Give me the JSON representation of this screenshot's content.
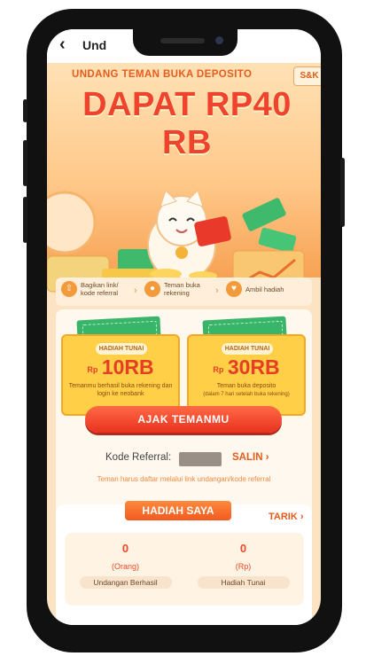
{
  "appbar": {
    "title": "Und",
    "back_icon": "chevron-left-icon"
  },
  "hero": {
    "subtitle": "UNDANG TEMAN BUKA DEPOSITO",
    "title": "DAPAT RP40 RB",
    "badge": "S&K"
  },
  "steps": [
    {
      "label": "Bagikan link/ kode referral",
      "icon": "share-icon"
    },
    {
      "label": "Teman buka rekening",
      "icon": "user-icon"
    },
    {
      "label": "Ambil hadiah",
      "icon": "gift-icon"
    }
  ],
  "coupons": [
    {
      "ribbon": "HADIAH TUNAI",
      "currency": "Rp",
      "amount": "10RB",
      "desc": "Temanmu berhasil buka rekening dan login ke neobank",
      "desc_note": ""
    },
    {
      "ribbon": "HADIAH TUNAI",
      "currency": "Rp",
      "amount": "30RB",
      "desc": "Teman buka deposito",
      "desc_note": "(dalam 7 hari setelah buka rekening)"
    }
  ],
  "cta": {
    "label": "AJAK TEMANMU"
  },
  "referral": {
    "label": "Kode Referral:",
    "copy": "SALIN",
    "note": "Teman harus daftar melalui link undangan/kode referral"
  },
  "reward": {
    "tab": "HADIAH SAYA",
    "withdraw": "TARIK",
    "stats": [
      {
        "value": "0",
        "unit": "(Orang)",
        "label": "Undangan Berhasil"
      },
      {
        "value": "0",
        "unit": "(Rp)",
        "label": "Hadiah Tunai"
      }
    ]
  },
  "colors": {
    "accent": "#e8321f",
    "orange": "#f25a1f",
    "gold": "#ffcf47"
  }
}
